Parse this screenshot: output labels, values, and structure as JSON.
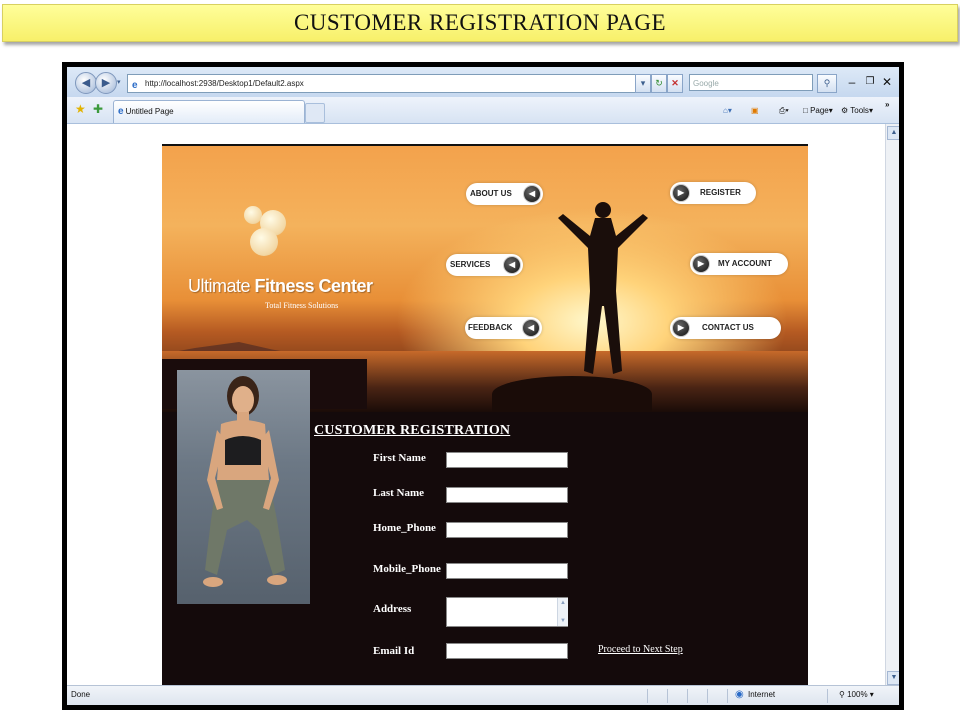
{
  "slide": {
    "title": "CUSTOMER REGISTRATION PAGE"
  },
  "browser": {
    "url": "http://localhost:2938/Desktop1/Default2.aspx",
    "search_placeholder": "Google",
    "tab_title": "Untitled Page",
    "commands": {
      "page": "Page",
      "tools": "Tools"
    },
    "status": {
      "left": "Done",
      "zone": "Internet",
      "zoom": "100%"
    }
  },
  "site": {
    "brand": {
      "word1": "Ultimate",
      "word2": "Fitness Center",
      "tagline": "Total Fitness Solutions"
    },
    "nav": {
      "about": "ABOUT US",
      "services": "SERVICES",
      "feedback": "FEEDBACK",
      "register": "REGISTER",
      "my_account": "MY ACCOUNT",
      "contact": "CONTACT US"
    },
    "form": {
      "title": "CUSTOMER REGISTRATION",
      "first_name": {
        "label": "First Name",
        "value": ""
      },
      "last_name": {
        "label": "Last Name",
        "value": ""
      },
      "home_phone": {
        "label": "Home_Phone",
        "value": ""
      },
      "mobile_phone": {
        "label": "Mobile_Phone",
        "value": ""
      },
      "address": {
        "label": "Address",
        "value": ""
      },
      "email": {
        "label": "Email Id",
        "value": ""
      },
      "proceed": "Proceed to Next Step"
    }
  },
  "colors": {
    "banner": "#f7f06a",
    "site_bg": "#140a0b",
    "sunset": "#f3a24c"
  }
}
